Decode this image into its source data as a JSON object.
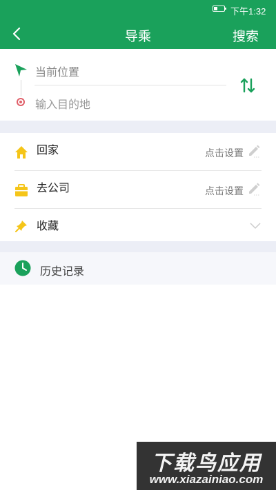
{
  "statusbar": {
    "time": "下午1:32",
    "battery_icon": "battery-icon"
  },
  "navbar": {
    "back_icon": "back-arrow-icon",
    "title": "导乘",
    "search_label": "搜索"
  },
  "route": {
    "from_placeholder": "当前位置",
    "to_placeholder": "输入目的地",
    "swap_icon": "swap-icon",
    "accent_color": "#1aa15b"
  },
  "places": [
    {
      "label": "回家",
      "action": "点击设置",
      "icon": "home-icon",
      "icon_color": "#f5c518"
    },
    {
      "label": "去公司",
      "action": "点击设置",
      "icon": "briefcase-icon",
      "icon_color": "#f5c518"
    },
    {
      "label": "收藏",
      "icon": "pin-icon",
      "icon_color": "#f5c518"
    }
  ],
  "history": {
    "label": "历史记录",
    "icon": "clock-icon"
  },
  "watermark": {
    "title": "下载鸟应用",
    "url": "www.xiazainiao.com"
  }
}
